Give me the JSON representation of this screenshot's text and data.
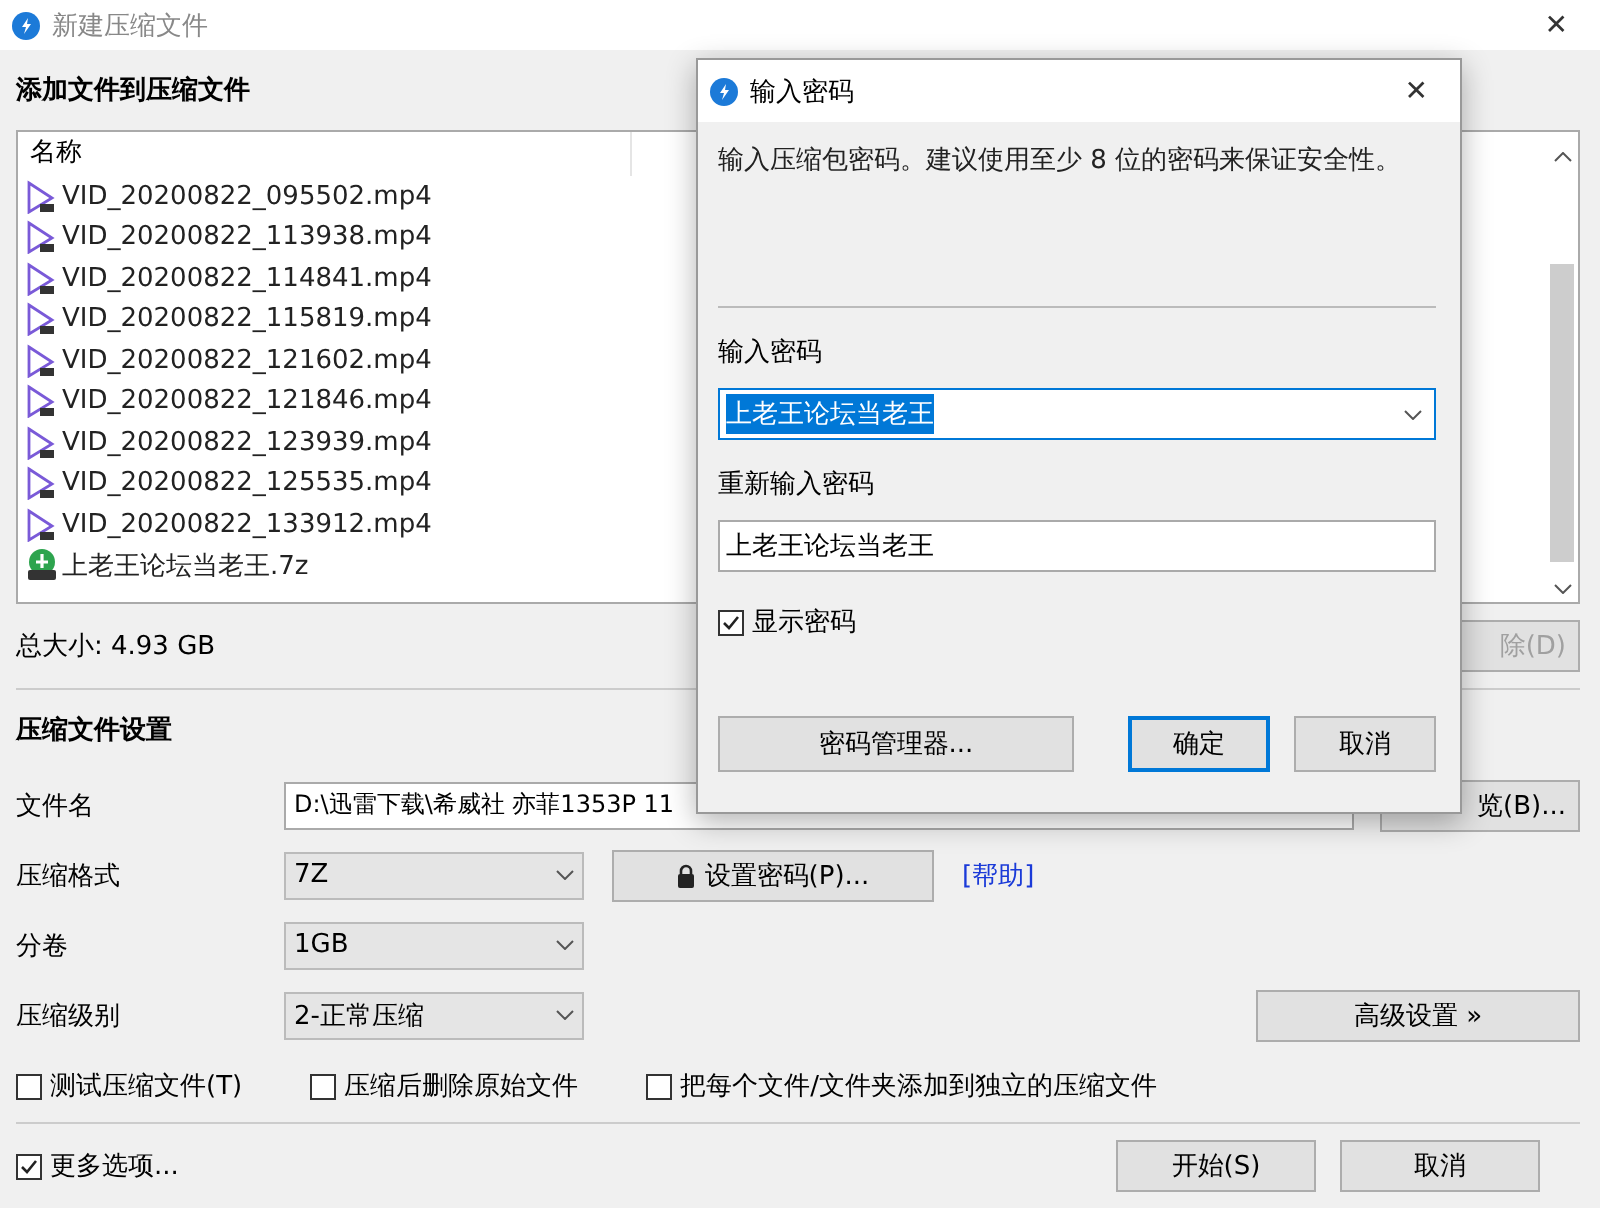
{
  "window": {
    "title": "新建压缩文件",
    "close": "✕"
  },
  "file_list": {
    "heading": "添加文件到压缩文件",
    "column_header": "名称",
    "files": [
      {
        "name": "VID_20200822_095502.mp4",
        "kind": "video"
      },
      {
        "name": "VID_20200822_113938.mp4",
        "kind": "video"
      },
      {
        "name": "VID_20200822_114841.mp4",
        "kind": "video"
      },
      {
        "name": "VID_20200822_115819.mp4",
        "kind": "video"
      },
      {
        "name": "VID_20200822_121602.mp4",
        "kind": "video"
      },
      {
        "name": "VID_20200822_121846.mp4",
        "kind": "video"
      },
      {
        "name": "VID_20200822_123939.mp4",
        "kind": "video"
      },
      {
        "name": "VID_20200822_125535.mp4",
        "kind": "video"
      },
      {
        "name": "VID_20200822_133912.mp4",
        "kind": "video"
      },
      {
        "name": "上老王论坛当老王.7z",
        "kind": "archive"
      }
    ]
  },
  "total_size": "总大小: 4.93 GB",
  "delete_button": {
    "label": "除(D)",
    "disabled": true
  },
  "settings": {
    "heading": "压缩文件设置",
    "file_name": {
      "label": "文件名",
      "value": "D:\\迅雷下载\\希威社 亦菲1353P 11",
      "browse": "览(B)..."
    },
    "format": {
      "label": "压缩格式",
      "value": "7Z",
      "password_button": "设置密码(P)...",
      "help_link": "[帮助]"
    },
    "volume": {
      "label": "分卷",
      "value": "1GB"
    },
    "level": {
      "label": "压缩级别",
      "value": "2-正常压缩",
      "advanced_button": "高级设置 »"
    },
    "options": [
      {
        "label": "测试压缩文件(T)",
        "checked": false
      },
      {
        "label": "压缩后删除原始文件",
        "checked": false
      },
      {
        "label": "把每个文件/文件夹添加到独立的压缩文件",
        "checked": false
      }
    ]
  },
  "more_options": {
    "label": "更多选项...",
    "checked": true
  },
  "buttons": [
    {
      "label": "开始(S)"
    },
    {
      "label": "取消"
    }
  ],
  "dialog": {
    "title": "输入密码",
    "close": "✕",
    "description": "输入压缩包密码。建议使用至少 8 位的密码来保证安全性。",
    "password": {
      "label": "输入密码",
      "value": "上老王论坛当老王",
      "text_selected": true
    },
    "confirm": {
      "label": "重新输入密码",
      "value": "上老王论坛当老王"
    },
    "show_password": {
      "label": "显示密码",
      "checked": true
    },
    "buttons": [
      {
        "label": "密码管理器...",
        "default": false
      },
      {
        "label": "确定",
        "default": true
      },
      {
        "label": "取消",
        "default": false
      }
    ]
  }
}
